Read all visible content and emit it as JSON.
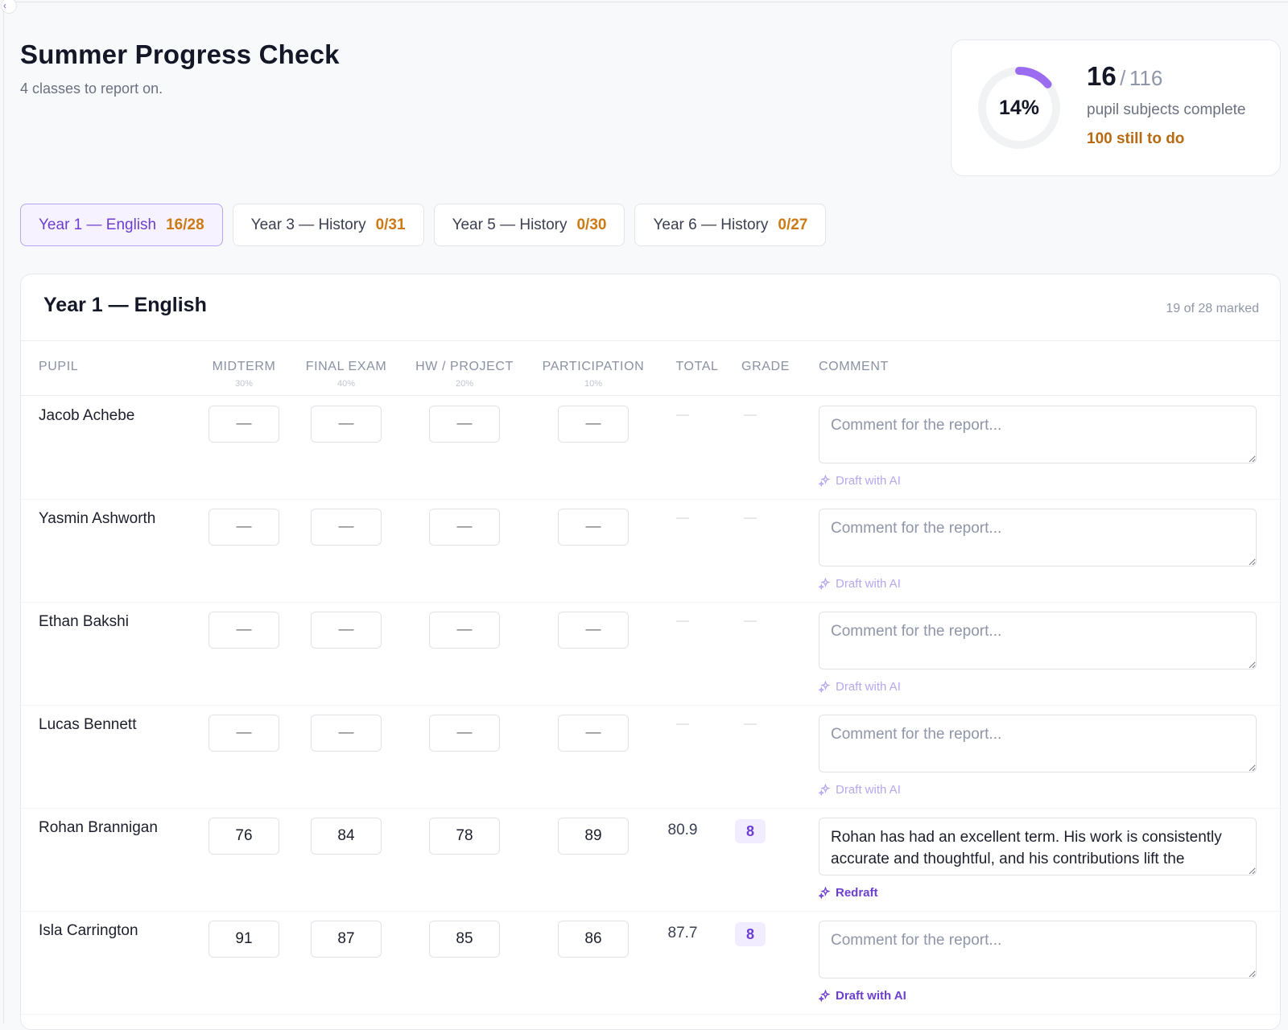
{
  "header": {
    "title": "Summer Progress Check",
    "subtitle": "4 classes to report on."
  },
  "progress": {
    "percent_label": "14%",
    "percent": 0.14,
    "done": "16",
    "separator": "/",
    "total": "116",
    "label": "pupil subjects complete",
    "remaining": "100 still to do"
  },
  "tabs": [
    {
      "label": "Year 1 — English",
      "count": "16/28",
      "active": true
    },
    {
      "label": "Year 3 — History",
      "count": "0/31",
      "active": false
    },
    {
      "label": "Year 5 — History",
      "count": "0/30",
      "active": false
    },
    {
      "label": "Year 6 — History",
      "count": "0/27",
      "active": false
    }
  ],
  "panel": {
    "title": "Year 1 — English",
    "meta": "19 of 28 marked",
    "columns": {
      "pupil": "PUPIL",
      "midterm": "MIDTERM",
      "midterm_weight": "30%",
      "final": "FINAL EXAM",
      "final_weight": "40%",
      "hw": "HW / PROJECT",
      "hw_weight": "20%",
      "participation": "PARTICIPATION",
      "participation_weight": "10%",
      "total": "TOTAL",
      "grade": "GRADE",
      "comment": "COMMENT"
    },
    "comment_placeholder": "Comment for the report...",
    "draft_label": "Draft with AI",
    "redraft_label": "Redraft",
    "empty_value": "—"
  },
  "rows": [
    {
      "name": "Jacob Achebe",
      "midterm": "",
      "final": "",
      "hw": "",
      "participation": "",
      "total": "—",
      "grade": "—",
      "comment": "",
      "action": "Draft with AI"
    },
    {
      "name": "Yasmin Ashworth",
      "midterm": "",
      "final": "",
      "hw": "",
      "participation": "",
      "total": "—",
      "grade": "—",
      "comment": "",
      "action": "Draft with AI"
    },
    {
      "name": "Ethan Bakshi",
      "midterm": "",
      "final": "",
      "hw": "",
      "participation": "",
      "total": "—",
      "grade": "—",
      "comment": "",
      "action": "Draft with AI"
    },
    {
      "name": "Lucas Bennett",
      "midterm": "",
      "final": "",
      "hw": "",
      "participation": "",
      "total": "—",
      "grade": "—",
      "comment": "",
      "action": "Draft with AI"
    },
    {
      "name": "Rohan Brannigan",
      "midterm": "76",
      "final": "84",
      "hw": "78",
      "participation": "89",
      "total": "80.9",
      "grade": "8",
      "comment": "Rohan has had an excellent term. His work is consistently accurate and thoughtful, and his contributions lift the",
      "action": "Redraft"
    },
    {
      "name": "Isla Carrington",
      "midterm": "91",
      "final": "87",
      "hw": "85",
      "participation": "86",
      "total": "87.7",
      "grade": "8",
      "comment": "",
      "action": "Draft with AI"
    }
  ],
  "colors": {
    "accent": "#6d3fd0",
    "accent_light": "#f6f2ff",
    "warning": "#cc7a14",
    "ring_track": "#f0f2f4",
    "ring_fill": "#9b6cf0"
  },
  "icons": {
    "back": "chevron-left-icon",
    "draft": "sparkle-icon"
  }
}
